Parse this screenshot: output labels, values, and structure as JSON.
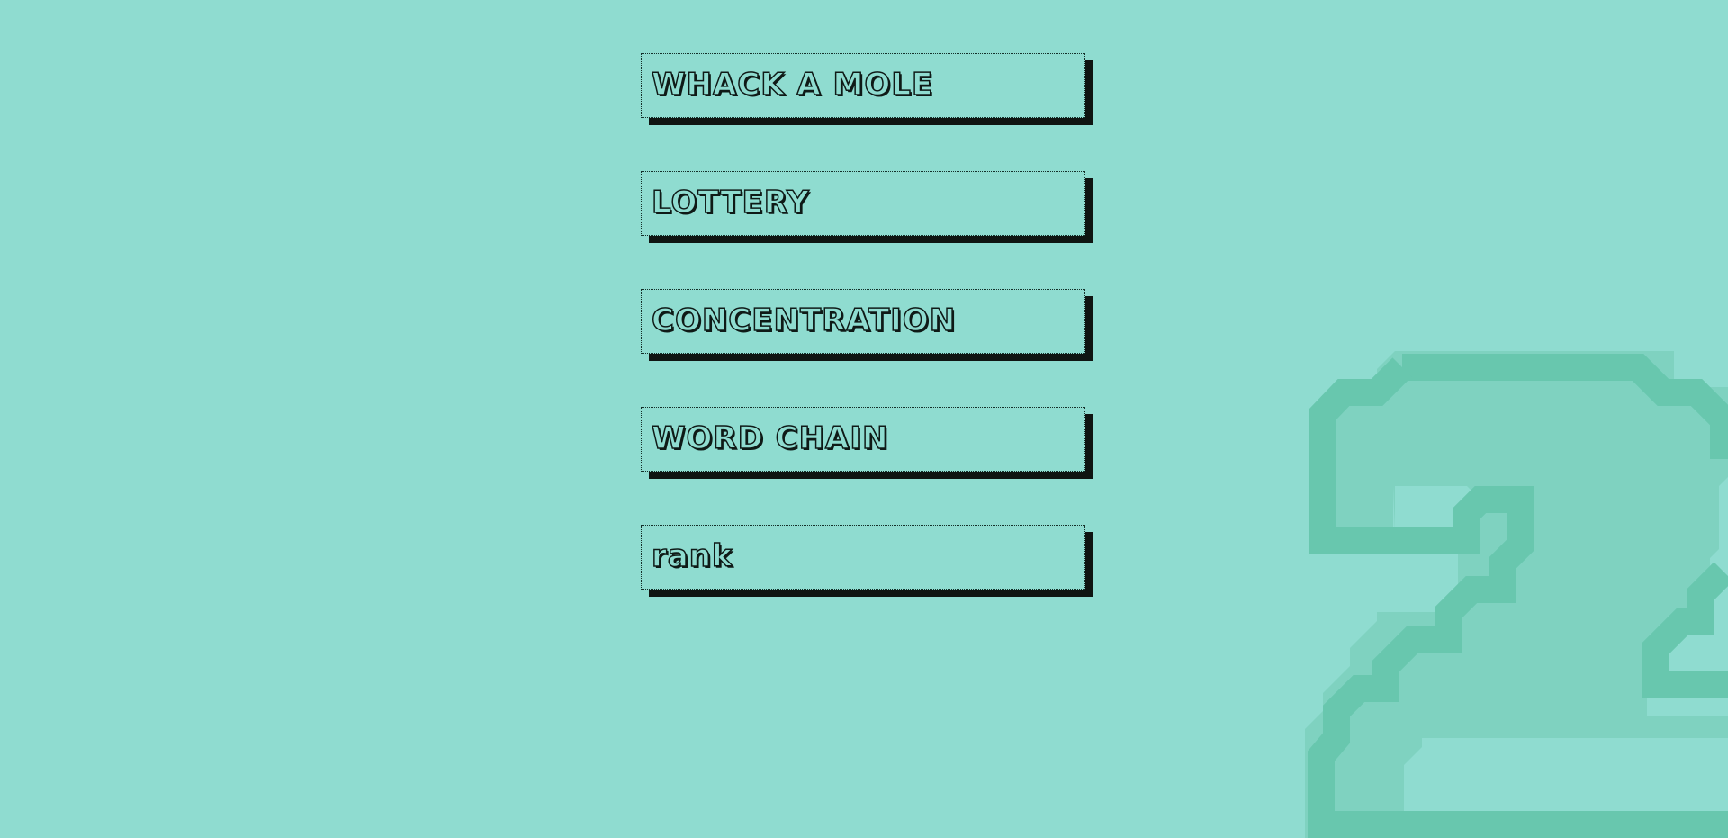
{
  "menu": {
    "items": [
      {
        "label": "WHACK A MOLE"
      },
      {
        "label": "LOTTERY"
      },
      {
        "label": "CONCENTRATION"
      },
      {
        "label": "WORD CHAIN"
      },
      {
        "label": "rank"
      }
    ]
  },
  "decoration": {
    "icon": "number-two-glyph",
    "colors": {
      "background": "#8fdcd0",
      "glyph_light": "#7fd2c0",
      "glyph_dark": "#6cc9b0",
      "button_shadow": "#0f1512",
      "text_outline": "#0f1a17"
    }
  }
}
